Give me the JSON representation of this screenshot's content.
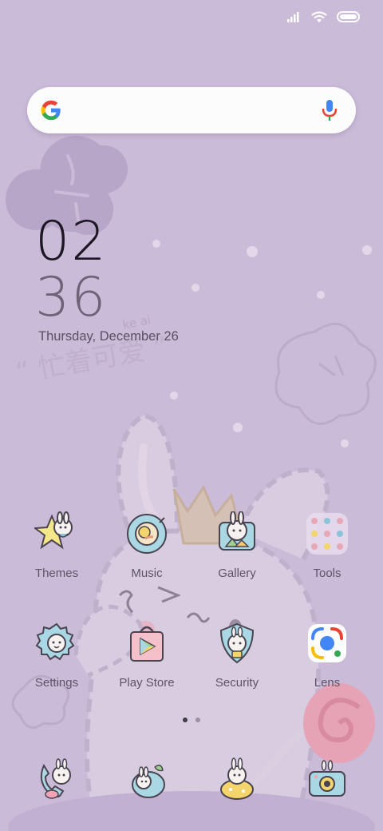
{
  "clock": {
    "hour": "02",
    "minute": "36",
    "date": "Thursday, December 26"
  },
  "search": {
    "logo_letter": "G"
  },
  "apps_row1": [
    {
      "label": "Themes",
      "icon": "themes-icon"
    },
    {
      "label": "Music",
      "icon": "music-icon"
    },
    {
      "label": "Gallery",
      "icon": "gallery-icon"
    },
    {
      "label": "Tools",
      "icon": "tools-folder-icon"
    }
  ],
  "apps_row2": [
    {
      "label": "Settings",
      "icon": "settings-icon"
    },
    {
      "label": "Play Store",
      "icon": "play-store-icon"
    },
    {
      "label": "Security",
      "icon": "security-icon"
    },
    {
      "label": "Lens",
      "icon": "lens-icon"
    }
  ],
  "dock": [
    {
      "icon": "phone-icon"
    },
    {
      "icon": "messages-icon"
    },
    {
      "icon": "browser-icon"
    },
    {
      "icon": "camera-icon"
    }
  ],
  "wallpaper": {
    "pinyin": "ke ai",
    "phrase": "“ 忙着可爱 ”"
  },
  "page_indicator": {
    "current": 1,
    "total": 2
  },
  "colors": {
    "background": "#cabbd9",
    "label": "#5e5466",
    "accent_pink": "#e6a3b5"
  }
}
